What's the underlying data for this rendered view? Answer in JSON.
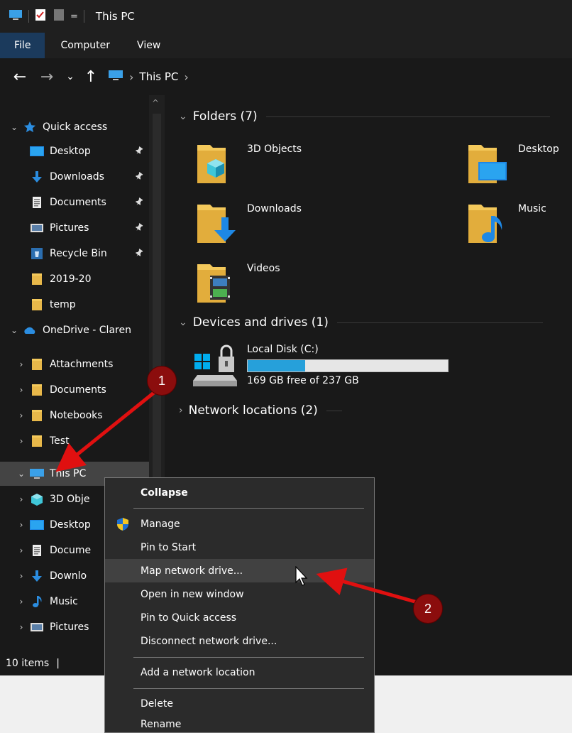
{
  "window": {
    "title": "This PC",
    "title_bar_divider": "="
  },
  "ribbon": {
    "tabs": [
      "File",
      "Computer",
      "View"
    ]
  },
  "address": {
    "back": "←",
    "forward": "→",
    "recent": "⌄",
    "up": "↑",
    "crumbs": [
      "This PC"
    ]
  },
  "sidebar": {
    "items": [
      {
        "label": "Quick access",
        "icon": "star-icon",
        "expander": "⌄",
        "pinned": false
      },
      {
        "label": "Desktop",
        "icon": "desktop-icon",
        "expander": "",
        "pinned": true
      },
      {
        "label": "Downloads",
        "icon": "download-icon",
        "expander": "",
        "pinned": true
      },
      {
        "label": "Documents",
        "icon": "document-icon",
        "expander": "",
        "pinned": true
      },
      {
        "label": "Pictures",
        "icon": "pictures-icon",
        "expander": "",
        "pinned": true
      },
      {
        "label": "Recycle Bin",
        "icon": "recycle-bin-icon",
        "expander": "",
        "pinned": true
      },
      {
        "label": "2019-20",
        "icon": "folder-icon",
        "expander": "",
        "pinned": false
      },
      {
        "label": "temp",
        "icon": "folder-icon",
        "expander": "",
        "pinned": false
      },
      {
        "label": "OneDrive - Claren",
        "icon": "onedrive-icon",
        "expander": "⌄",
        "pinned": false
      },
      {
        "label": "Attachments",
        "icon": "folder-icon",
        "expander": "›",
        "pinned": false
      },
      {
        "label": "Documents",
        "icon": "folder-icon",
        "expander": "›",
        "pinned": false
      },
      {
        "label": "Notebooks",
        "icon": "folder-icon",
        "expander": "›",
        "pinned": false
      },
      {
        "label": "Test",
        "icon": "folder-icon",
        "expander": "›",
        "pinned": false
      },
      {
        "label": "This PC",
        "icon": "this-pc-icon",
        "expander": "⌄",
        "pinned": false,
        "selected": true
      },
      {
        "label": "3D Obje",
        "icon": "3d-objects-icon",
        "expander": "›",
        "pinned": false
      },
      {
        "label": "Desktop",
        "icon": "desktop-icon",
        "expander": "›",
        "pinned": false
      },
      {
        "label": "Docume",
        "icon": "document-icon",
        "expander": "›",
        "pinned": false
      },
      {
        "label": "Downlo",
        "icon": "download-icon",
        "expander": "›",
        "pinned": false
      },
      {
        "label": "Music",
        "icon": "music-icon",
        "expander": "›",
        "pinned": false
      },
      {
        "label": "Pictures",
        "icon": "pictures-icon",
        "expander": "›",
        "pinned": false
      }
    ],
    "pin_glyph": "📌"
  },
  "main": {
    "folders_header": "Folders (7)",
    "folders": [
      {
        "label": "3D Objects",
        "icon": "3d-objects-folder-icon"
      },
      {
        "label": "Desktop",
        "icon": "desktop-folder-icon"
      },
      {
        "label": "Downloads",
        "icon": "downloads-folder-icon"
      },
      {
        "label": "Music",
        "icon": "music-folder-icon"
      },
      {
        "label": "Videos",
        "icon": "videos-folder-icon"
      }
    ],
    "devices_header": "Devices and drives (1)",
    "drive": {
      "name": "Local Disk (C:)",
      "free_text": "169 GB free of 237 GB",
      "used_fraction": 0.287,
      "icon": "local-disk-icon"
    },
    "network_header": "Network locations (2)"
  },
  "status": {
    "items_text": "10 items",
    "sep": "|"
  },
  "context_menu": {
    "items": [
      {
        "label": "Collapse",
        "bold": true
      },
      {
        "label": "Manage",
        "icon": "uac-shield-icon"
      },
      {
        "label": "Pin to Start"
      },
      {
        "label": "Map network drive...",
        "hover": true
      },
      {
        "label": "Open in new window"
      },
      {
        "label": "Pin to Quick access"
      },
      {
        "label": "Disconnect network drive..."
      },
      {
        "label": "Add a network location"
      },
      {
        "label": "Delete"
      },
      {
        "label": "Rename"
      }
    ]
  },
  "annotations": {
    "badge1": "1",
    "badge2": "2",
    "color": "#e01010"
  }
}
